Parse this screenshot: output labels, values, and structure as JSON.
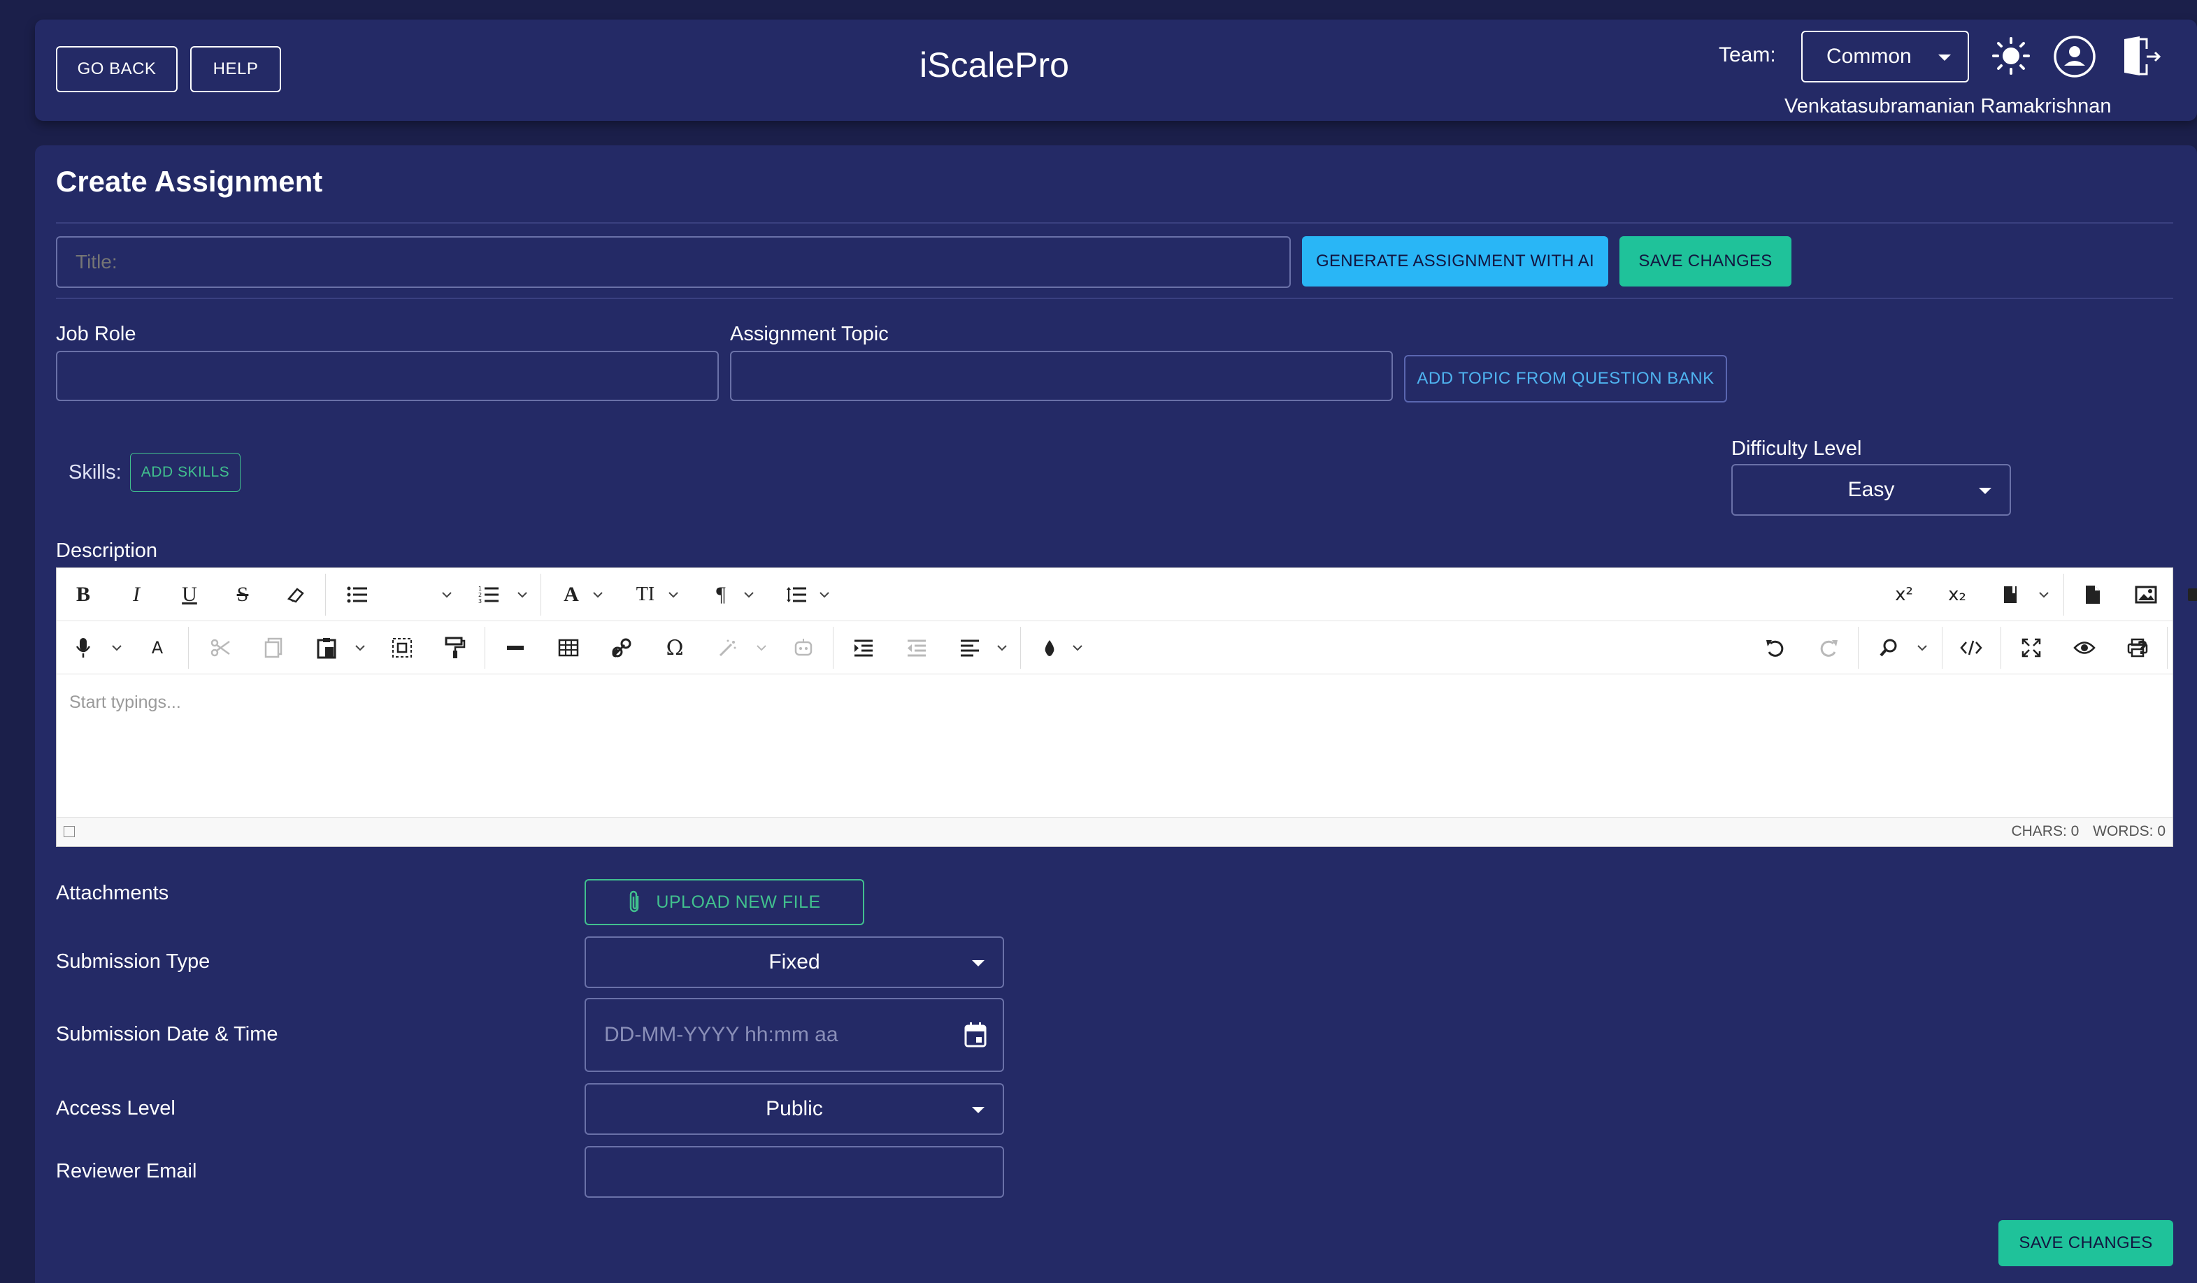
{
  "header": {
    "go_back": "GO BACK",
    "help": "HELP",
    "app_title": "iScalePro",
    "team_label": "Team:",
    "team_value": "Common",
    "user_name": "Venkatasubramanian Ramakrishnan"
  },
  "page": {
    "title": "Create Assignment",
    "title_placeholder": "Title:",
    "generate_ai": "GENERATE ASSIGNMENT WITH AI",
    "save_top": "SAVE CHANGES",
    "job_role_label": "Job Role",
    "assignment_topic_label": "Assignment Topic",
    "add_topic": "ADD TOPIC FROM QUESTION BANK",
    "skills_label": "Skills:",
    "add_skills": "ADD SKILLS",
    "difficulty_label": "Difficulty Level",
    "difficulty_value": "Easy",
    "description_label": "Description"
  },
  "editor": {
    "placeholder": "Start typings...",
    "chars": "CHARS: 0",
    "words": "WORDS: 0"
  },
  "form": {
    "attachments_label": "Attachments",
    "upload": "UPLOAD NEW FILE",
    "submission_type_label": "Submission Type",
    "submission_type_value": "Fixed",
    "submission_date_label": "Submission Date & Time",
    "submission_date_placeholder": "DD-MM-YYYY hh:mm aa",
    "access_level_label": "Access Level",
    "access_level_value": "Public",
    "reviewer_email_label": "Reviewer Email",
    "save_bottom": "SAVE CHANGES"
  },
  "colors": {
    "background": "#1b1f4a",
    "panel": "#242a66",
    "ai_button": "#29b6f6",
    "save_button": "#1fc29a",
    "accent_blue": "#4fb3f0",
    "accent_green": "#41c08e"
  }
}
